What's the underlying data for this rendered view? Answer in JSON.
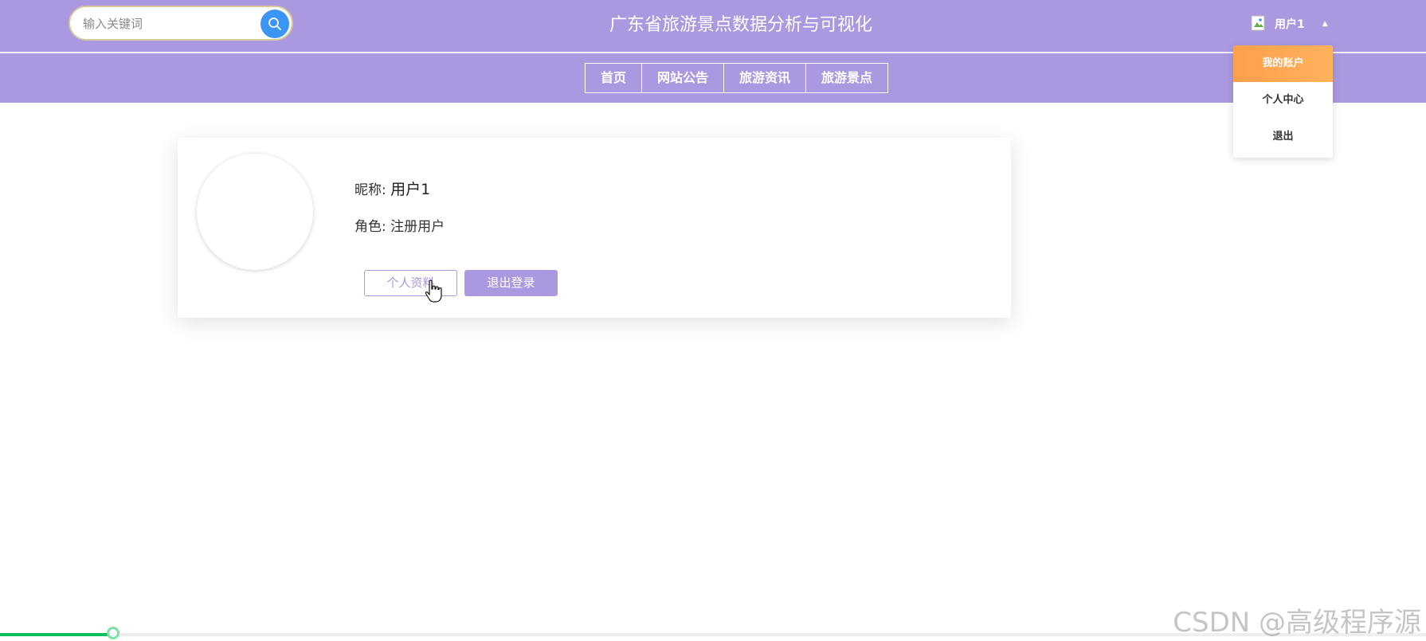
{
  "header": {
    "title": "广东省旅游景点数据分析与可视化",
    "search_placeholder": "输入关键词",
    "user_name": "用户1"
  },
  "nav": {
    "items": [
      "首页",
      "网站公告",
      "旅游资讯",
      "旅游景点"
    ]
  },
  "dropdown": {
    "items": [
      "我的账户",
      "个人中心",
      "退出"
    ]
  },
  "profile": {
    "nickname_label": "昵称:",
    "nickname_value": "用户1",
    "role_label": "角色:",
    "role_value": "注册用户",
    "btn_profile": "个人资料",
    "btn_logout": "退出登录"
  },
  "progress": {
    "fraction": 0.08
  },
  "watermark": "CSDN @高级程序源",
  "colors": {
    "header_bg": "#aa99e1",
    "search_button": "#3a95f4",
    "dropdown_active": "#fd9f4c",
    "progress": "#0cc15a"
  }
}
